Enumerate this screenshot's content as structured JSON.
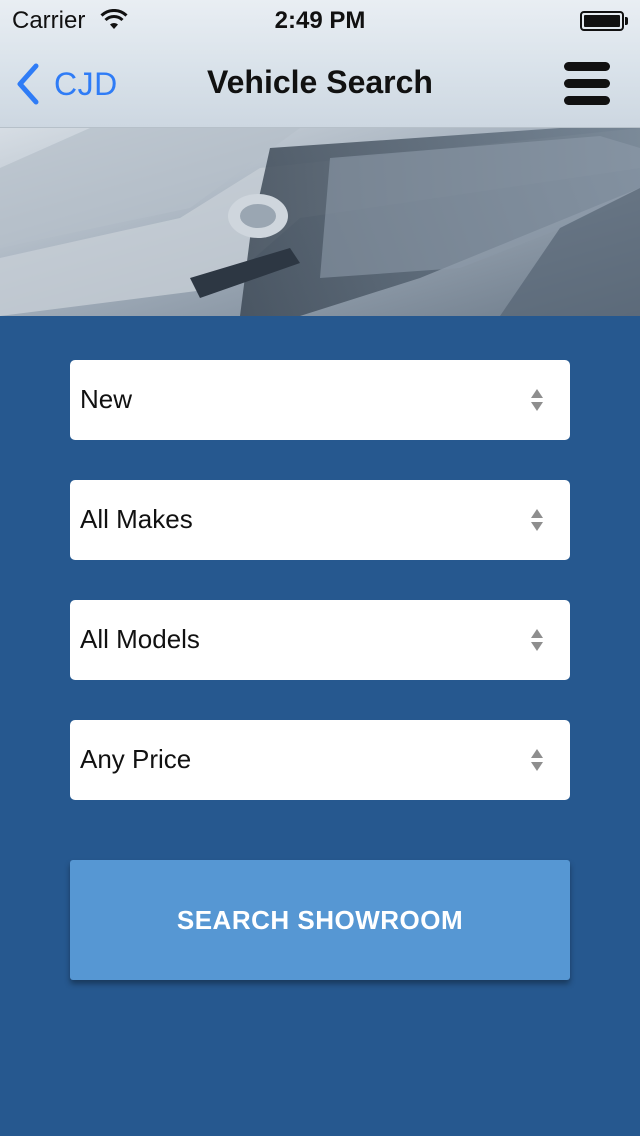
{
  "status_bar": {
    "carrier": "Carrier",
    "time": "2:49 PM"
  },
  "nav": {
    "back_label": "CJD",
    "title": "Vehicle Search"
  },
  "filters": [
    {
      "value": "New"
    },
    {
      "value": "All Makes"
    },
    {
      "value": "All Models"
    },
    {
      "value": "Any Price"
    }
  ],
  "search_button": {
    "label": "SEARCH SHOWROOM"
  },
  "colors": {
    "background": "#26588f",
    "accent_blue": "#2f7cf6",
    "button": "#5697d3"
  },
  "icons": {
    "back": "chevron-left-icon",
    "menu": "hamburger-menu-icon",
    "wifi": "wifi-icon",
    "battery": "battery-icon",
    "select_arrows": "updown-arrows-icon"
  }
}
